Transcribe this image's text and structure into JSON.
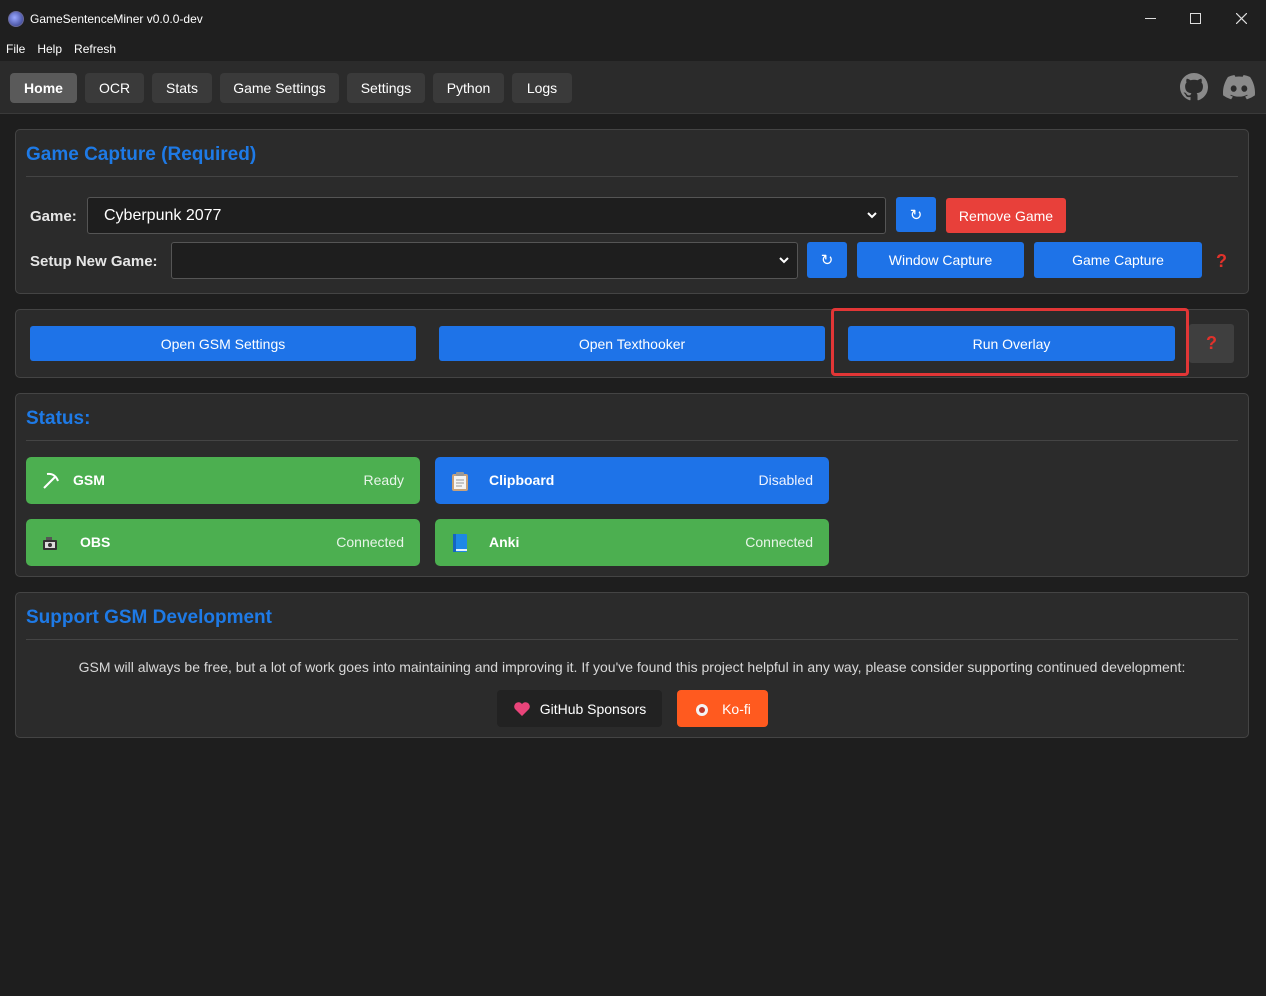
{
  "window": {
    "title": "GameSentenceMiner v0.0.0-dev"
  },
  "menu": [
    "File",
    "Help",
    "Refresh"
  ],
  "tabs": [
    {
      "label": "Home",
      "active": true
    },
    {
      "label": "OCR"
    },
    {
      "label": "Stats"
    },
    {
      "label": "Game Settings"
    },
    {
      "label": "Settings"
    },
    {
      "label": "Python"
    },
    {
      "label": "Logs"
    }
  ],
  "external_icons": [
    "github-icon",
    "discord-icon"
  ],
  "game_capture": {
    "title": "Game Capture (Required)",
    "game_label": "Game:",
    "game_value": "Cyberpunk 2077",
    "refresh_symbol": "↻",
    "remove_label": "Remove Game",
    "setup_label": "Setup New Game:",
    "setup_value": "",
    "window_capture_label": "Window Capture",
    "game_capture_label": "Game Capture",
    "help_symbol": "?"
  },
  "actions": {
    "open_settings": "Open GSM Settings",
    "open_texthooker": "Open Texthooker",
    "run_overlay": "Run Overlay",
    "help_symbol": "?"
  },
  "status": {
    "title": "Status:",
    "items": [
      {
        "name": "GSM",
        "value": "Ready",
        "icon": "pickaxe-icon",
        "color": "#4caf50"
      },
      {
        "name": "Clipboard",
        "value": "Disabled",
        "icon": "clipboard-icon",
        "color": "#1e73e8"
      },
      {
        "name": "OBS",
        "value": "Connected",
        "icon": "camera-icon",
        "color": "#4caf50"
      },
      {
        "name": "Anki",
        "value": "Connected",
        "icon": "book-icon",
        "color": "#4caf50"
      }
    ]
  },
  "support": {
    "title": "Support GSM Development",
    "text": "GSM will always be free, but a lot of work goes into maintaining and improving it. If you've found this project helpful in any way, please consider supporting continued development:",
    "github_label": "GitHub Sponsors",
    "kofi_label": "Ko-fi"
  },
  "colors": {
    "accent": "#1e73e8",
    "danger": "#e8403a",
    "success": "#4caf50",
    "kofi": "#ff5a1f"
  }
}
